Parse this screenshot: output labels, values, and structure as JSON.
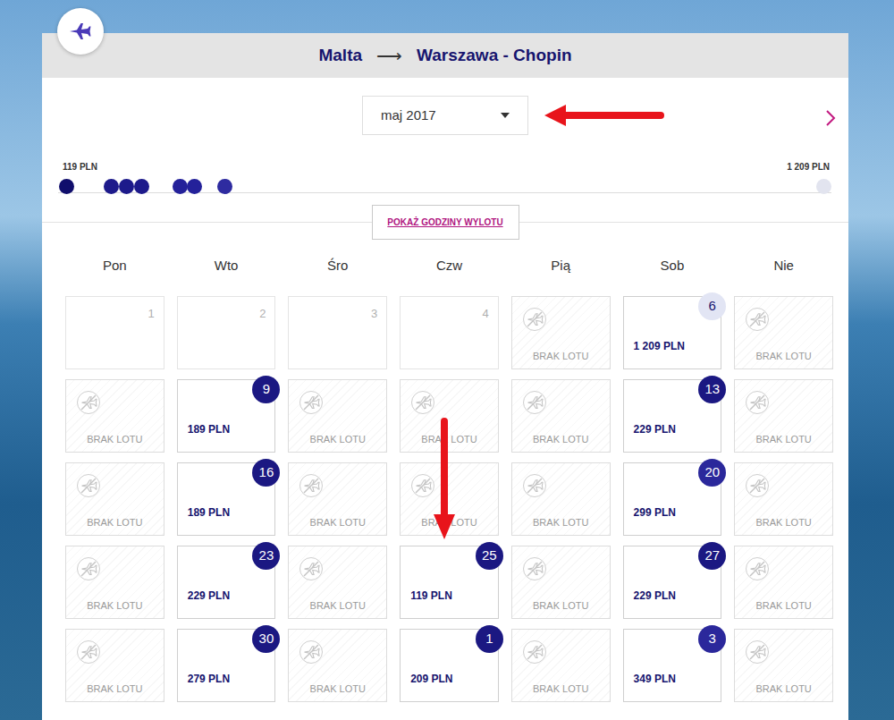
{
  "header": {
    "origin": "Malta",
    "arrow": "⟶",
    "destination": "Warszawa - Chopin"
  },
  "month": {
    "label": "maj 2017"
  },
  "price_range": {
    "min": "119 PLN",
    "max": "1 209 PLN",
    "dots": [
      {
        "level": 0,
        "color": "#100e6c"
      },
      {
        "level": 0.06,
        "color": "#1d1a8b"
      },
      {
        "level": 0.08,
        "color": "#1d1a8b"
      },
      {
        "level": 0.1,
        "color": "#1d1a8b"
      },
      {
        "level": 0.15,
        "color": "#24219a"
      },
      {
        "level": 0.17,
        "color": "#24219a"
      },
      {
        "level": 0.21,
        "color": "#2e2ba0"
      },
      {
        "level": 1,
        "color": "#e2e4ef"
      }
    ]
  },
  "show_times_button": "POKAŻ GODZINY WYLOTU",
  "weekdays": [
    "Pon",
    "Wto",
    "Śro",
    "Czw",
    "Pią",
    "Sob",
    "Nie"
  ],
  "calendar": {
    "weeks": [
      [
        {
          "kind": "empty",
          "day": "1"
        },
        {
          "kind": "empty",
          "day": "2"
        },
        {
          "kind": "empty",
          "day": "3"
        },
        {
          "kind": "empty",
          "day": "4"
        },
        {
          "kind": "none",
          "label": "BRAK LOTU"
        },
        {
          "kind": "flight",
          "day": "6",
          "price": "1 209 PLN",
          "color": "#e2e5f4"
        },
        {
          "kind": "none",
          "label": "BRAK LOTU"
        }
      ],
      [
        {
          "kind": "none",
          "label": "BRAK LOTU"
        },
        {
          "kind": "flight",
          "day": "9",
          "price": "189 PLN",
          "color": "#1b1882"
        },
        {
          "kind": "none",
          "label": "BRAK LOTU"
        },
        {
          "kind": "none",
          "label": "BRAK LOTU"
        },
        {
          "kind": "none",
          "label": "BRAK LOTU"
        },
        {
          "kind": "flight",
          "day": "13",
          "price": "229 PLN",
          "color": "#1b1882"
        },
        {
          "kind": "none",
          "label": "BRAK LOTU"
        }
      ],
      [
        {
          "kind": "none",
          "label": "BRAK LOTU"
        },
        {
          "kind": "flight",
          "day": "16",
          "price": "189 PLN",
          "color": "#1b1882"
        },
        {
          "kind": "none",
          "label": "BRAK LOTU"
        },
        {
          "kind": "none",
          "label": "BRAK LOTU"
        },
        {
          "kind": "none",
          "label": "BRAK LOTU"
        },
        {
          "kind": "flight",
          "day": "20",
          "price": "299 PLN",
          "color": "#2b289b"
        },
        {
          "kind": "none",
          "label": "BRAK LOTU"
        }
      ],
      [
        {
          "kind": "none",
          "label": "BRAK LOTU"
        },
        {
          "kind": "flight",
          "day": "23",
          "price": "229 PLN",
          "color": "#1b1882"
        },
        {
          "kind": "none",
          "label": "BRAK LOTU"
        },
        {
          "kind": "flight",
          "day": "25",
          "price": "119 PLN",
          "color": "#1b1882"
        },
        {
          "kind": "none",
          "label": "BRAK LOTU"
        },
        {
          "kind": "flight",
          "day": "27",
          "price": "229 PLN",
          "color": "#1b1882"
        },
        {
          "kind": "none",
          "label": "BRAK LOTU"
        }
      ],
      [
        {
          "kind": "none",
          "label": "BRAK LOTU"
        },
        {
          "kind": "flight",
          "day": "30",
          "price": "279 PLN",
          "color": "#1b1882"
        },
        {
          "kind": "none",
          "label": "BRAK LOTU"
        },
        {
          "kind": "flight",
          "day": "1",
          "price": "209 PLN",
          "color": "#1b1882"
        },
        {
          "kind": "none",
          "label": "BRAK LOTU"
        },
        {
          "kind": "flight",
          "day": "3",
          "price": "349 PLN",
          "color": "#2b289b"
        },
        {
          "kind": "none",
          "label": "BRAK LOTU"
        }
      ]
    ]
  }
}
